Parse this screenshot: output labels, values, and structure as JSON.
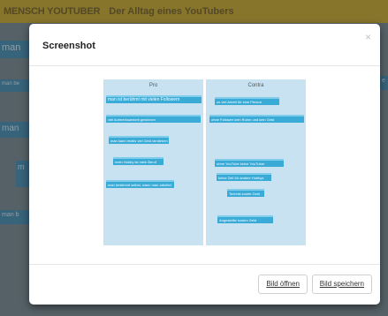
{
  "app": {
    "logo": "MENSCH YOUTUBER",
    "title": "Der Alltag eines YouTubers",
    "bg_tiles": [
      "man",
      "man be",
      "man",
      "m",
      "man b",
      "e"
    ]
  },
  "modal": {
    "title": "Screenshot",
    "close_label": "×",
    "open_button": "Bild öffnen",
    "save_button": "Bild speichern"
  },
  "screenshot": {
    "pro_heading": "Pro",
    "contra_heading": "Contra",
    "pro_cards": [
      "man ist berühmt mit vielen Followern",
      "viel Aufmerksamkeit gewinnen",
      "man kann relativ viel Geld verdienen",
      "mein Hobby ist mein Beruf",
      "man bestimmt selbst, wann man arbeitet"
    ],
    "contra_cards": [
      "zu viel Arbeit für eine Person",
      "ohne Follower kein Ruhm und kein Geld",
      "ohne YouTube keine YouTuber",
      "keine Zeit für andere Hobbys",
      "Technik kostet Geld",
      "Angestellte kosten Geld"
    ]
  }
}
